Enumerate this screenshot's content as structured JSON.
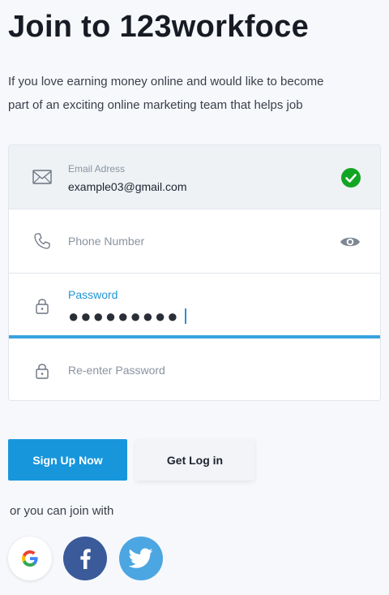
{
  "header": {
    "title": "Join to 123workfoce",
    "intro_line1": "If you love earning money online and would like to become",
    "intro_line2": "part of an exciting online marketing team that helps job"
  },
  "form": {
    "email": {
      "label": "Email Adress",
      "value": "example03@gmail.com",
      "status_icon": "check-circle-icon",
      "status_color": "#12a524"
    },
    "phone": {
      "placeholder": "Phone Number",
      "icon": "phone-icon",
      "action_icon": "eye-icon"
    },
    "password": {
      "label": "Password",
      "masked_value": "●●●●●●●●●",
      "icon": "lock-icon",
      "focus_color": "#3aa2de"
    },
    "confirm_password": {
      "placeholder": "Re-enter Password",
      "icon": "lock-icon"
    }
  },
  "actions": {
    "signup_label": "Sign Up Now",
    "login_label": "Get Log in",
    "primary_color": "#1796dc"
  },
  "social": {
    "prompt": "or you can join with",
    "providers": [
      {
        "name": "google",
        "icon": "google-icon"
      },
      {
        "name": "facebook",
        "icon": "facebook-icon",
        "color": "#3a5a9a"
      },
      {
        "name": "twitter",
        "icon": "twitter-icon",
        "color": "#4ca6e2"
      }
    ]
  }
}
